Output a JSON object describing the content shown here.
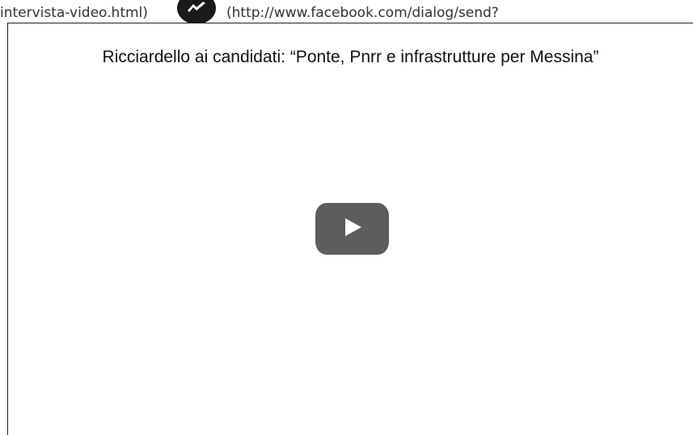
{
  "share_strip": {
    "left_link_text": "intervista-video.html)",
    "right_link_text": "(http://www.facebook.com/dialog/send?",
    "messenger_icon": "messenger-icon"
  },
  "video": {
    "title": "Ricciardello ai candidati: “Ponte, Pnrr e infrastrutture per Messina”",
    "play_icon": "play-icon"
  }
}
